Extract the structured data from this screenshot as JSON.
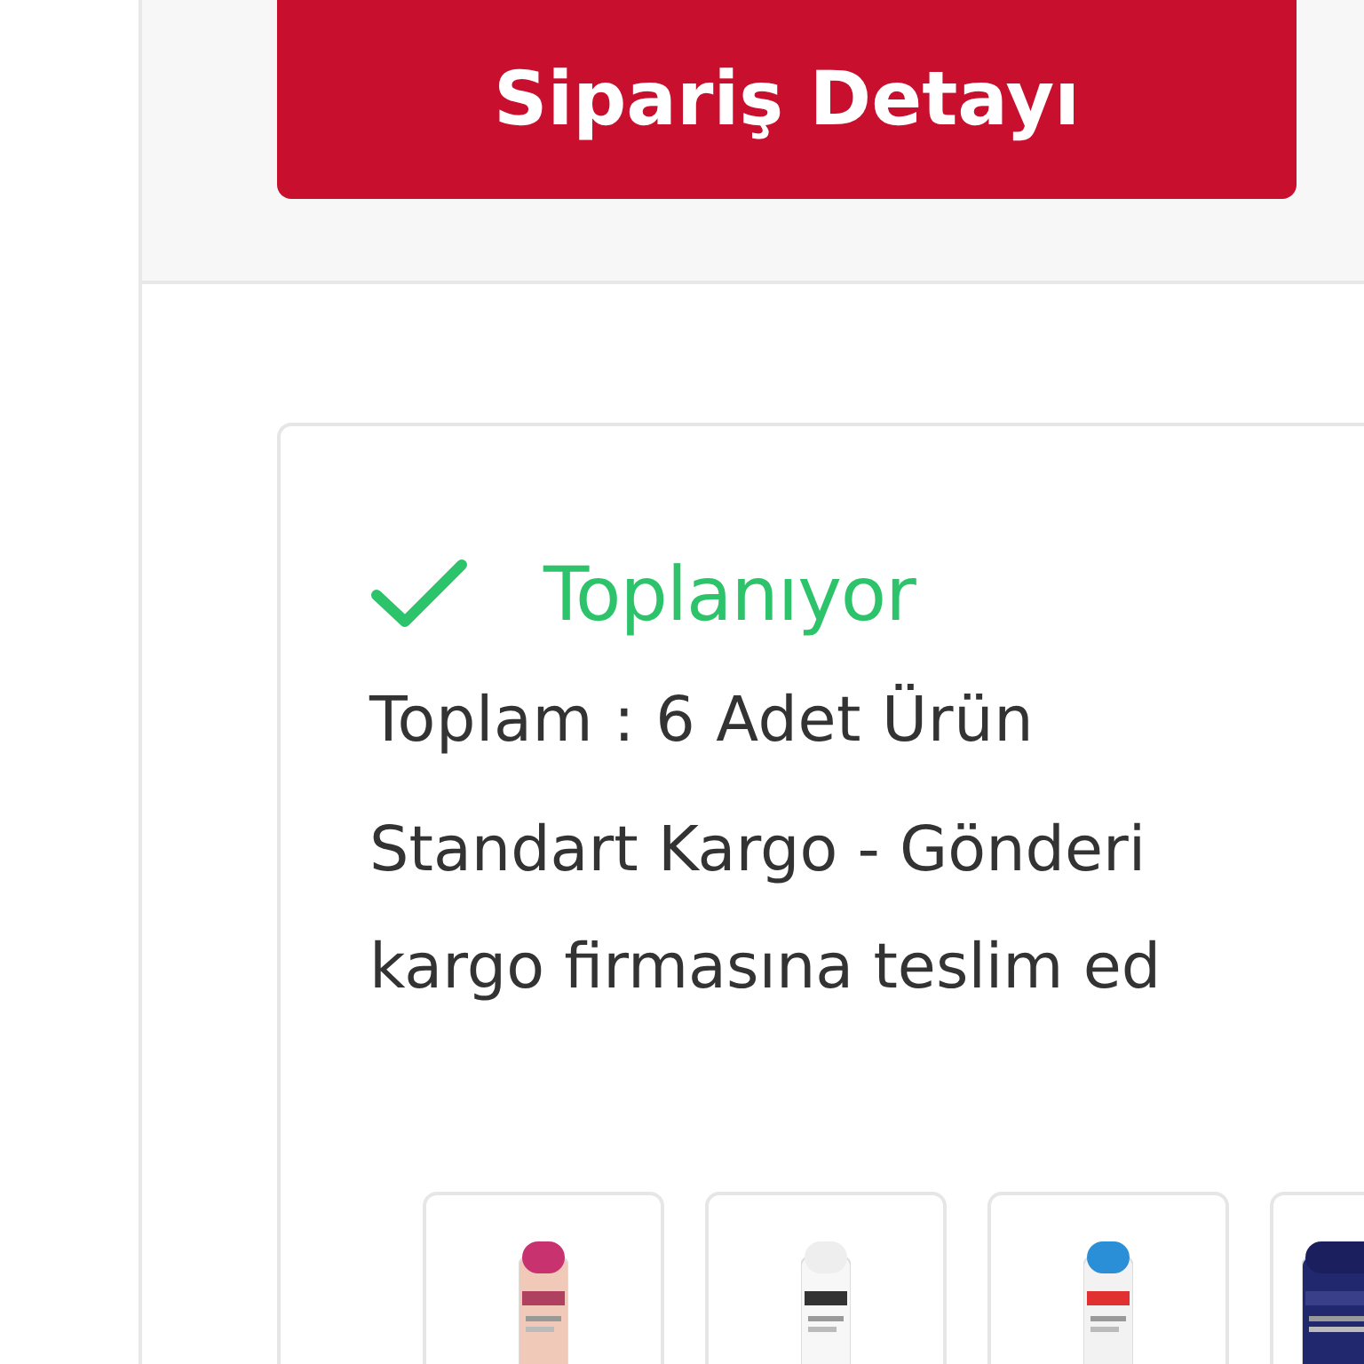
{
  "header": {
    "button": "Sipariş Detayı"
  },
  "order": {
    "status": {
      "kind": "done",
      "label": "Toplanıyor"
    },
    "total": "Toplam : 6 Adet Ürün",
    "shipping_lines": [
      "Standart Kargo - Gönderi",
      "kargo firmasına teslim ed"
    ]
  }
}
